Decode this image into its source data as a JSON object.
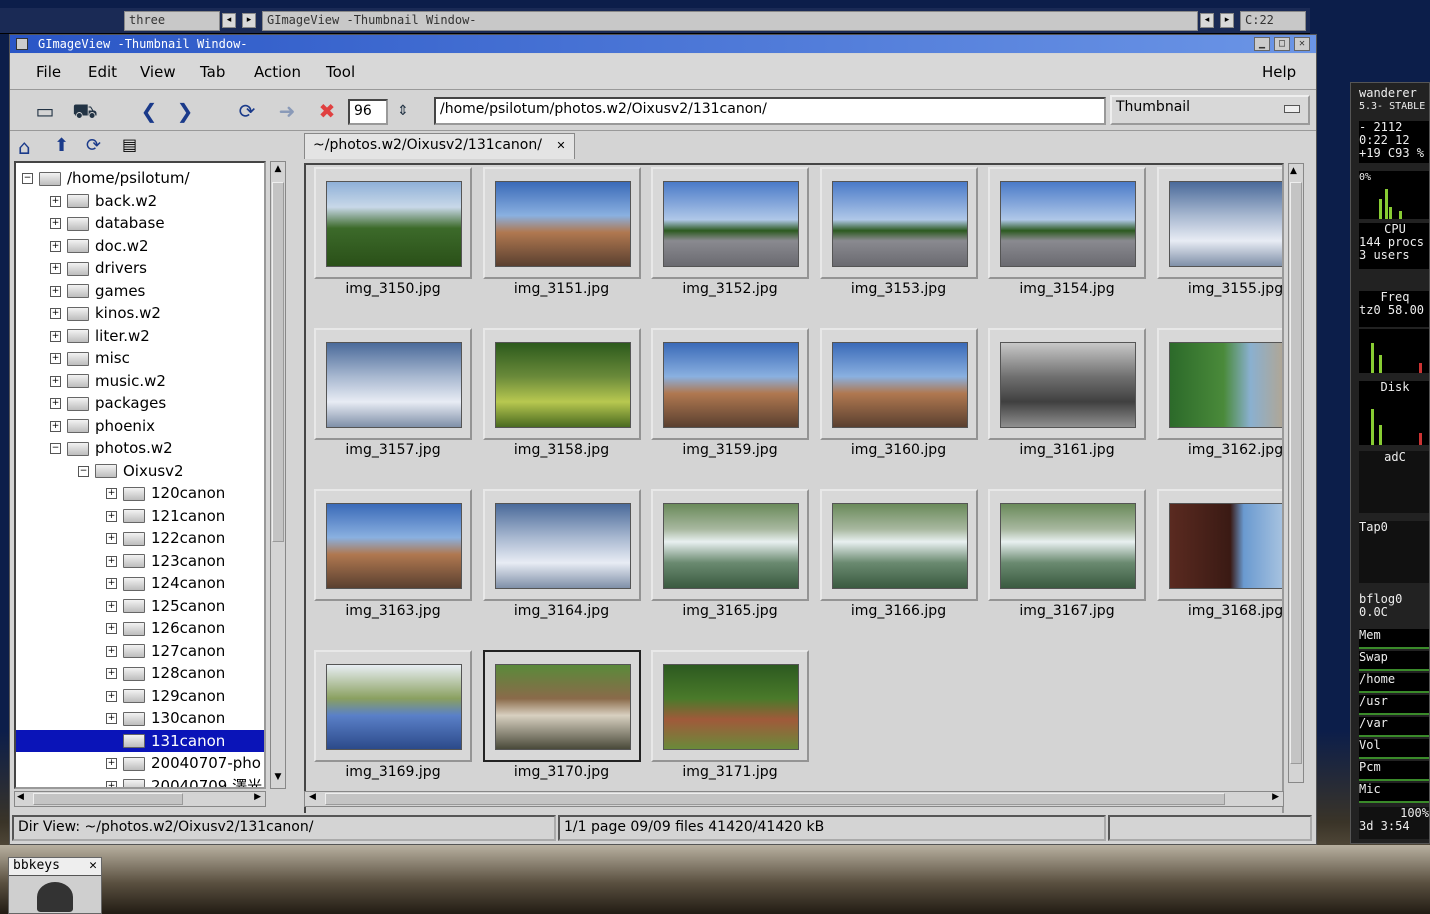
{
  "taskbar": {
    "items": [
      "three",
      "GImageView -Thumbnail Window-"
    ],
    "clock": "C:22"
  },
  "window": {
    "title": "GImageView -Thumbnail Window-"
  },
  "menu": {
    "left": [
      "File",
      "Edit",
      "View",
      "Tab",
      "Action",
      "Tool"
    ],
    "help": "Help"
  },
  "toolbar": {
    "zoom_value": "96",
    "path_value": "/home/psilotum/photos.w2/Oixusv2/131canon/",
    "view_mode": "Thumbnail",
    "icons": [
      "folder-open-icon",
      "car-icon",
      "back-arrow-icon",
      "forward-arrow-icon",
      "refresh-icon",
      "go-arrow-icon",
      "stop-icon"
    ]
  },
  "tree_toolbar": {
    "icons": [
      "home-icon",
      "up-arrow-icon",
      "refresh-icon",
      "document-icon"
    ]
  },
  "tree": {
    "items": [
      {
        "label": "/home/psilotum/",
        "level": 0,
        "sign": "−"
      },
      {
        "label": "back.w2",
        "level": 1,
        "sign": "+"
      },
      {
        "label": "database",
        "level": 1,
        "sign": "+"
      },
      {
        "label": "doc.w2",
        "level": 1,
        "sign": "+"
      },
      {
        "label": "drivers",
        "level": 1,
        "sign": "+"
      },
      {
        "label": "games",
        "level": 1,
        "sign": "+"
      },
      {
        "label": "kinos.w2",
        "level": 1,
        "sign": "+"
      },
      {
        "label": "liter.w2",
        "level": 1,
        "sign": "+"
      },
      {
        "label": "misc",
        "level": 1,
        "sign": "+"
      },
      {
        "label": "music.w2",
        "level": 1,
        "sign": "+"
      },
      {
        "label": "packages",
        "level": 1,
        "sign": "+"
      },
      {
        "label": "phoenix",
        "level": 1,
        "sign": "+"
      },
      {
        "label": "photos.w2",
        "level": 1,
        "sign": "−"
      },
      {
        "label": "Oixusv2",
        "level": 2,
        "sign": "−"
      },
      {
        "label": "120canon",
        "level": 3,
        "sign": "+"
      },
      {
        "label": "121canon",
        "level": 3,
        "sign": "+"
      },
      {
        "label": "122canon",
        "level": 3,
        "sign": "+"
      },
      {
        "label": "123canon",
        "level": 3,
        "sign": "+"
      },
      {
        "label": "124canon",
        "level": 3,
        "sign": "+"
      },
      {
        "label": "125canon",
        "level": 3,
        "sign": "+"
      },
      {
        "label": "126canon",
        "level": 3,
        "sign": "+"
      },
      {
        "label": "127canon",
        "level": 3,
        "sign": "+"
      },
      {
        "label": "128canon",
        "level": 3,
        "sign": "+"
      },
      {
        "label": "129canon",
        "level": 3,
        "sign": "+"
      },
      {
        "label": "130canon",
        "level": 3,
        "sign": "+"
      },
      {
        "label": "131canon",
        "level": 3,
        "sign": "",
        "selected": true
      },
      {
        "label": "20040707-pho",
        "level": 3,
        "sign": "+"
      },
      {
        "label": "20040709 澤光",
        "level": 3,
        "sign": "+"
      }
    ]
  },
  "tab": {
    "label": "~/photos.w2/Oixusv2/131canon/"
  },
  "thumbnails": [
    {
      "name": "img_3150.jpg",
      "scene": "grass"
    },
    {
      "name": "img_3151.jpg",
      "scene": "building"
    },
    {
      "name": "img_3152.jpg",
      "scene": "plaza"
    },
    {
      "name": "img_3153.jpg",
      "scene": "plaza"
    },
    {
      "name": "img_3154.jpg",
      "scene": "plaza"
    },
    {
      "name": "img_3155.jpg",
      "scene": "sky"
    },
    {
      "name": "img_3157.jpg",
      "scene": "sky"
    },
    {
      "name": "img_3158.jpg",
      "scene": "path"
    },
    {
      "name": "img_3159.jpg",
      "scene": "building"
    },
    {
      "name": "img_3160.jpg",
      "scene": "building"
    },
    {
      "name": "img_3161.jpg",
      "scene": "mono"
    },
    {
      "name": "img_3162.jpg",
      "scene": "trees"
    },
    {
      "name": "img_3163.jpg",
      "scene": "building"
    },
    {
      "name": "img_3164.jpg",
      "scene": "sky"
    },
    {
      "name": "img_3165.jpg",
      "scene": "fountain"
    },
    {
      "name": "img_3166.jpg",
      "scene": "fountain"
    },
    {
      "name": "img_3167.jpg",
      "scene": "fountain"
    },
    {
      "name": "img_3168.jpg",
      "scene": "wall"
    },
    {
      "name": "img_3169.jpg",
      "scene": "roof"
    },
    {
      "name": "img_3170.jpg",
      "scene": "street",
      "selected": true
    },
    {
      "name": "img_3171.jpg",
      "scene": "garden"
    }
  ],
  "status": {
    "dir_view": "Dir View: ~/photos.w2/Oixusv2/131canon/",
    "page_info": "1/1 page  09/09 files  41420/41420 kB"
  },
  "dock": {
    "host": "wanderer",
    "kernel": "5.3- STABLE",
    "time1": "- 2112",
    "time2": "0:22 12",
    "temp": "+19 C93 %",
    "cpu_pct": "0%",
    "cpu": "CPU",
    "procs": "144 procs",
    "users": "3 users",
    "freq": "Freq",
    "freq_val": "tz0 58.00",
    "disk": "Disk",
    "adc": "adC",
    "tap": "Tap0",
    "bflog": "bflog0",
    "bflog_val": "0.0C",
    "bars": [
      "Mem",
      "Swap",
      "/home",
      "/usr",
      "/var",
      "Vol",
      "Pcm",
      "Mic"
    ],
    "vol_pct": "100%",
    "uptime": "3d 3:54"
  },
  "bottom_app": {
    "title": "bbkeys"
  }
}
